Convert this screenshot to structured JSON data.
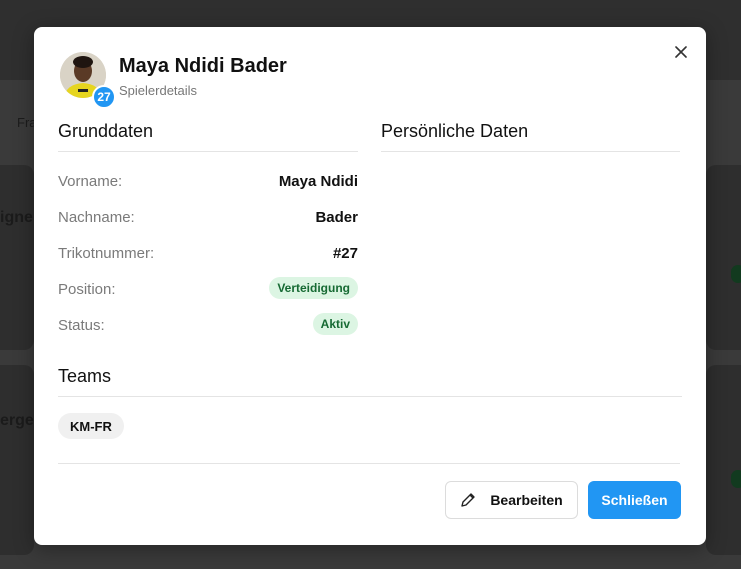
{
  "background": {
    "tab_fragment": "Fra",
    "card1_fragment": "igne",
    "card2_fragment": "erge"
  },
  "modal": {
    "player_name": "Maya Ndidi Bader",
    "subtitle": "Spielerdetails",
    "jersey_badge": "27",
    "close_icon": "close-icon"
  },
  "basic": {
    "title": "Grunddaten",
    "rows": [
      {
        "label": "Vorname:",
        "value": "Maya Ndidi"
      },
      {
        "label": "Nachname:",
        "value": "Bader"
      },
      {
        "label": "Trikotnummer:",
        "value": "#27"
      },
      {
        "label": "Position:",
        "value": "Verteidigung"
      },
      {
        "label": "Status:",
        "value": "Aktiv"
      }
    ]
  },
  "personal": {
    "title": "Persönliche Daten"
  },
  "teams": {
    "title": "Teams",
    "items": [
      "KM-FR"
    ]
  },
  "footer": {
    "edit_label": "Bearbeiten",
    "close_label": "Schließen",
    "edit_icon": "pencil-icon"
  },
  "colors": {
    "primary": "#2196f3",
    "success_bg": "#dcf5e3",
    "success_text": "#166a33"
  }
}
